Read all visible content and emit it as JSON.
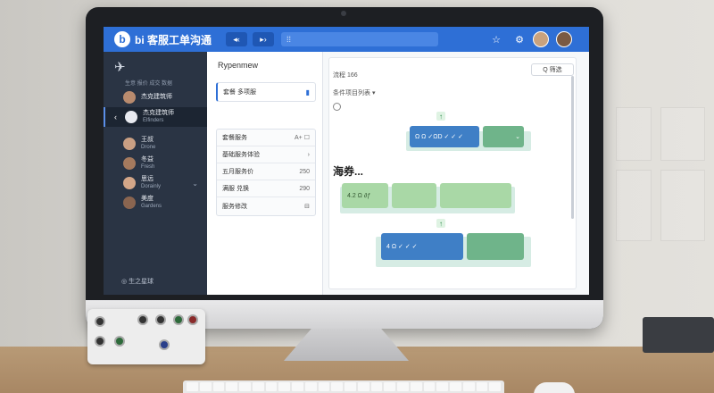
{
  "app": {
    "logo_glyph": "b",
    "title": "bi 客服工单沟通",
    "nav_back": "◂‹",
    "nav_forward": "▸›",
    "search_glyph": "⁞⁞",
    "icons": [
      "star-icon",
      "gear-icon"
    ]
  },
  "sidebar": {
    "logo_icon": "plane-icon",
    "header_label": "生意 报价 成交 数据",
    "items": [
      {
        "name": "杰克建筑师",
        "sub": "Elfinders",
        "active": true
      },
      {
        "name": "王叔",
        "sub": "Drone",
        "active": false
      },
      {
        "name": "冬益",
        "sub": "Fresh",
        "active": false
      },
      {
        "name": "思远",
        "sub": "Dorainly",
        "active": false
      },
      {
        "name": "美度",
        "sub": "Gardens",
        "active": false
      }
    ],
    "footer": "生之星球"
  },
  "middle": {
    "title": "Rypenmew",
    "cards": [
      {
        "label": "套餐  多项服",
        "selected": true
      }
    ],
    "rows": [
      {
        "label": "套餐服务",
        "value": "A+ ☐"
      },
      {
        "label": "基础服务体验",
        "value": "›"
      },
      {
        "label": "五月服务价",
        "value": "250"
      },
      {
        "label": "满服  兑换",
        "value": "290"
      },
      {
        "label": "服务修改",
        "value": "⊟"
      }
    ]
  },
  "flow": {
    "header": "流程  166",
    "sub_header": "条件项目列表  ▾",
    "select_label": "Q 筛选",
    "section_label": "海券...",
    "nodes": [
      {
        "text": "Ω Ω ✓ΩD  ✓ ✓ ✓"
      },
      {
        "text": "4.2 Ω ∂ƒ"
      },
      {
        "text": "4 Ω ✓ ✓ ✓"
      }
    ]
  }
}
